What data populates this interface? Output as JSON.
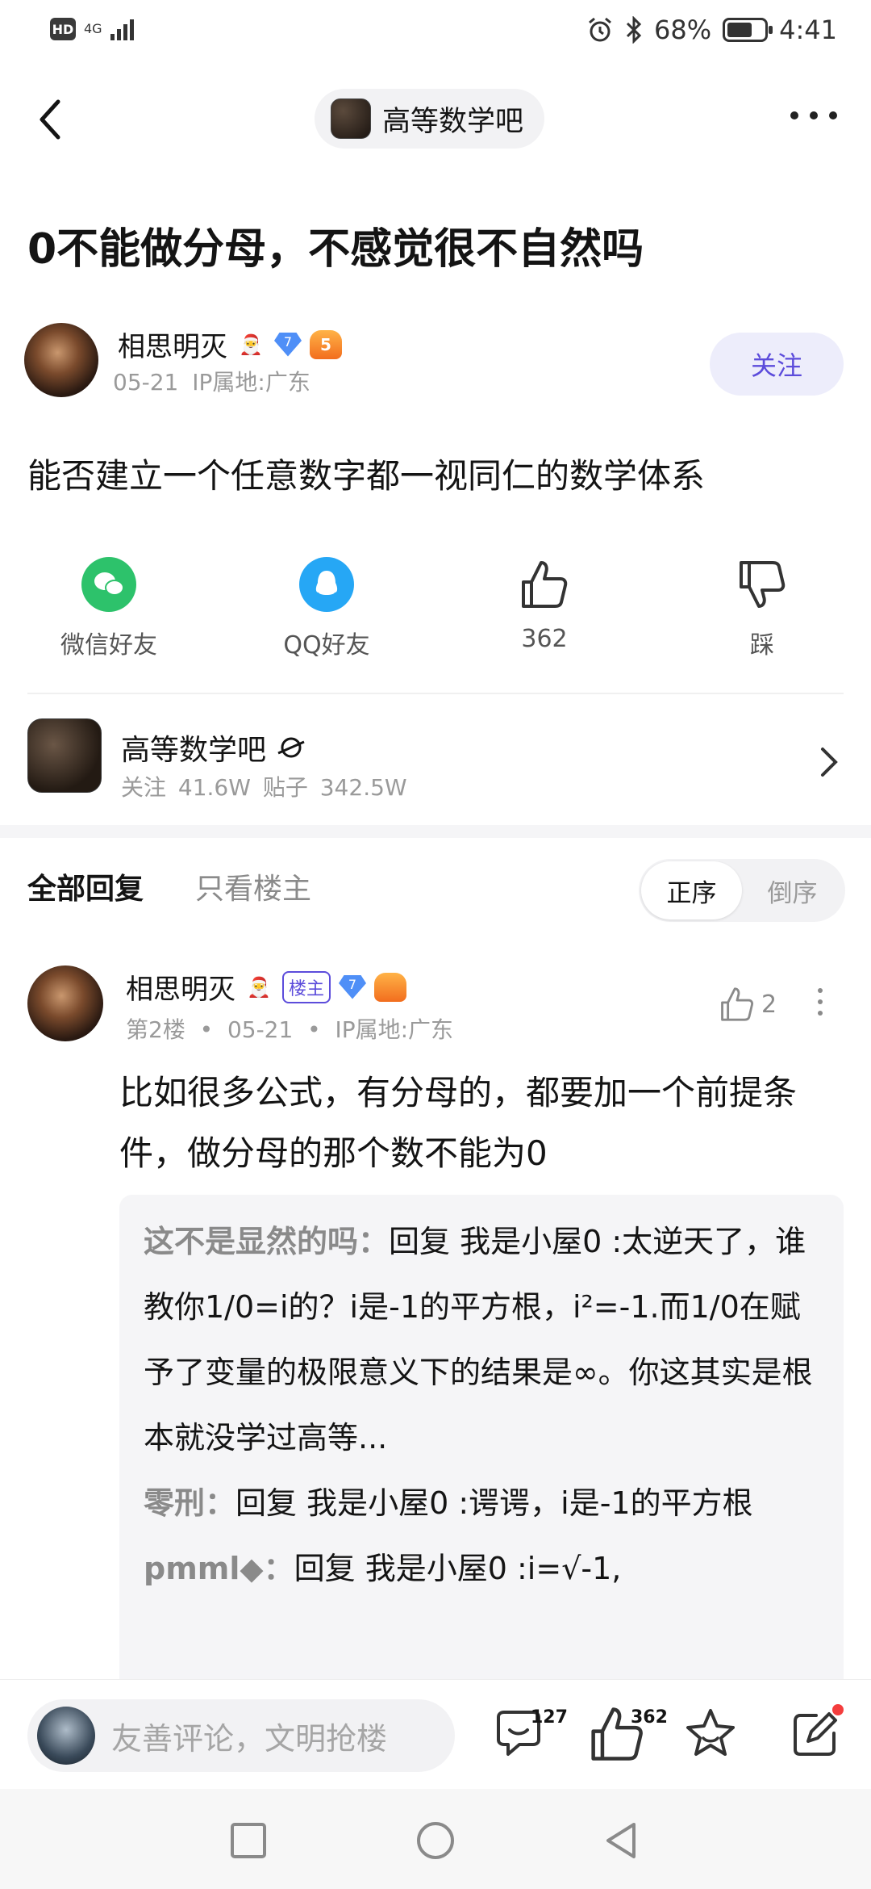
{
  "status_bar": {
    "hd": "HD",
    "network": "4G",
    "battery_text": "68%",
    "battery_level": 0.68,
    "time": "4:41"
  },
  "nav": {
    "forum_name": "高等数学吧"
  },
  "post": {
    "title": "0不能做分母，不感觉很不自然吗",
    "author": "相思明灭",
    "author_level": "5",
    "author_gem": "7",
    "date": "05-21",
    "ip": "IP属地:广东",
    "follow_label": "关注",
    "body": "能否建立一个任意数字都一视同仁的数学体系"
  },
  "actions": {
    "wechat": "微信好友",
    "qq": "QQ好友",
    "likes": "362",
    "dislike": "踩"
  },
  "forum_card": {
    "name": "高等数学吧",
    "followers": "关注 41.6W",
    "posts": "贴子 342.5W"
  },
  "reply_tabs": {
    "all": "全部回复",
    "op_only": "只看楼主",
    "sort_asc": "正序",
    "sort_desc": "倒序"
  },
  "reply": {
    "author": "相思明灭",
    "op_tag": "楼主",
    "gem": "7",
    "floor": "第2楼",
    "date": "05-21",
    "ip": "IP属地:广东",
    "likes": "2",
    "text": "比如很多公式，有分母的，都要加一个前提条件，做分母的那个数不能为0",
    "sub_replies": [
      {
        "author": "这不是显然的吗：",
        "text": "回复 我是小屋0 :太逆天了，谁教你1/0=i的？i是-1的平方根，i²=-1.而1/0在赋予了变量的极限意义下的结果是∞。你这其实是根本就没学过高等..."
      },
      {
        "author": "零刑：",
        "text": "回复 我是小屋0 :谔谔，i是-1的平方根"
      },
      {
        "author": "pmml◆：",
        "text": "回复 我是小屋0 :i=√-1,"
      }
    ]
  },
  "bottom_bar": {
    "placeholder": "友善评论，文明抢楼",
    "comments": "127",
    "likes": "362"
  }
}
